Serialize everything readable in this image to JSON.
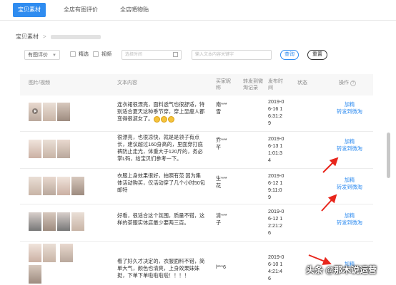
{
  "tabs": [
    {
      "label": "宝贝素材",
      "active": true
    },
    {
      "label": "全店有图评价",
      "active": false
    },
    {
      "label": "全店晒物贴",
      "active": false
    }
  ],
  "breadcrumb": {
    "root": "宝贝素材",
    "separator": ">"
  },
  "filters": {
    "type_select": "有图评价",
    "check_featured": "精选",
    "check_video": "视频",
    "date_placeholder": "选择时间",
    "keyword_placeholder": "输入文本内容关键字",
    "search_label": "查询",
    "reset_label": "重置"
  },
  "headers": {
    "image": "图片/视频",
    "text": "文本内容",
    "buyer": "买家昵称",
    "repost": "转发到微淘记录",
    "time": "发布时间",
    "status": "状态",
    "ops": "操作"
  },
  "rows": [
    {
      "text": "连衣裙很漂亮，面料透气也很舒适，特别适合夏天这种季节穿，穿上显瘦人都变得很淑女了。",
      "buyer": "南***雪",
      "time": [
        "2019-0",
        "6-16 1",
        "6:31:2",
        "9"
      ],
      "op_add": "加精",
      "op_repost": "转发到微淘"
    },
    {
      "text": "很漂亮，也很凉快，就是是领子有点长，建议超过160身高的，里面穿打底裤防止走光，体重大于120斤的，务必掌L码，给宝贝们参考一下。",
      "buyer": "乔***芊",
      "time": [
        "2019-0",
        "6-13 1",
        "1:01:3",
        "4"
      ],
      "op_add": "加精",
      "op_repost": "转发到微淘"
    },
    {
      "text": "衣服上身效果很好，拍照有范 因为集体活动购买，仅活动穿了几个小时50包邮特",
      "buyer": "生***花",
      "time": [
        "2019-0",
        "6-12 1",
        "9:11:0",
        "9"
      ],
      "op_add": "加精",
      "op_repost": "转发到微淘"
    },
    {
      "text": "好看，很适合这个氛围，质量不错，这样的茶服实体店最少要两三百。",
      "buyer": "清***子",
      "time": [
        "2019-0",
        "6-12 1",
        "2:21:2",
        "6"
      ],
      "op_add": "加精",
      "op_repost": "转发到微淘"
    },
    {
      "text": "看了好久才决定的，衣服面料不错，简单大气，颜色也清爽，上身效果妹妹挺，下单下单啦啦啦啦！！！！",
      "buyer": "l***6",
      "time": [
        "2019-0",
        "6-10 1",
        "4:21:4",
        "6"
      ],
      "op_add": "加精",
      "op_repost": ""
    }
  ],
  "watermark": "头条 @那木说运营",
  "colors": {
    "accent": "#2f8cf0",
    "arrow": "#e8261c"
  }
}
